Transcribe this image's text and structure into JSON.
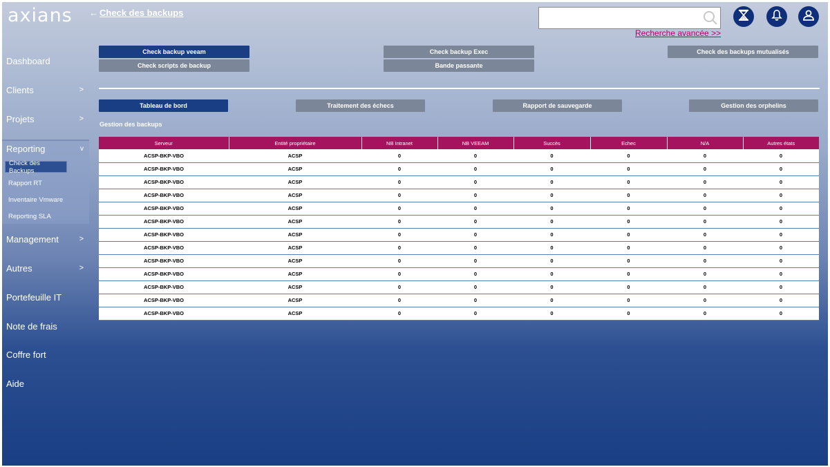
{
  "header": {
    "logo": "axians",
    "back_arrow": "←",
    "title": "Check des backups",
    "search_placeholder": "",
    "advanced_search": "Recherche avancée >>"
  },
  "sidebar": {
    "items": [
      {
        "label": "Dashboard",
        "chevron": ""
      },
      {
        "label": "Clients",
        "chevron": ">"
      },
      {
        "label": "Projets",
        "chevron": ">"
      },
      {
        "label": "Management",
        "chevron": ">"
      },
      {
        "label": "Autres",
        "chevron": ">"
      },
      {
        "label": "Portefeuille IT",
        "chevron": ""
      },
      {
        "label": "Note de frais",
        "chevron": ""
      },
      {
        "label": "Coffre fort",
        "chevron": ""
      },
      {
        "label": "Aide",
        "chevron": ""
      }
    ],
    "reporting": {
      "label": "Reporting",
      "chevron": "v",
      "sub_items": [
        "Check des Backups",
        "Rapport RT",
        "Inventaire Vmware",
        "Reporting SLA"
      ]
    }
  },
  "top_buttons": {
    "check_veeam": "Check backup veeam",
    "check_exec": "Check backup Exec",
    "check_mutualises": "Check des backups mutualisés",
    "check_scripts": "Check scripts de backup",
    "bande_passante": "Bande passante"
  },
  "tabs": {
    "tableau": "Tableau de bord",
    "traitement": "Traitement des échecs",
    "rapport": "Rapport de sauvegarde",
    "orphelins": "Gestion des orphelins"
  },
  "section_title": "Gestion des backups",
  "table": {
    "columns": [
      "Serveur",
      "Entité propriétaire",
      "NB Intranet",
      "NB VEEAM",
      "Succès",
      "Echec",
      "N/A",
      "Autres états"
    ],
    "rows": [
      [
        "ACSP-BKP-VBO",
        "ACSP",
        "0",
        "0",
        "0",
        "0",
        "0",
        "0"
      ],
      [
        "ACSP-BKP-VBO",
        "ACSP",
        "0",
        "0",
        "0",
        "0",
        "0",
        "0"
      ],
      [
        "ACSP-BKP-VBO",
        "ACSP",
        "0",
        "0",
        "0",
        "0",
        "0",
        "0"
      ],
      [
        "ACSP-BKP-VBO",
        "ACSP",
        "0",
        "0",
        "0",
        "0",
        "0",
        "0"
      ],
      [
        "ACSP-BKP-VBO",
        "ACSP",
        "0",
        "0",
        "0",
        "0",
        "0",
        "0"
      ],
      [
        "ACSP-BKP-VBO",
        "ACSP",
        "0",
        "0",
        "0",
        "0",
        "0",
        "0"
      ],
      [
        "ACSP-BKP-VBO",
        "ACSP",
        "0",
        "0",
        "0",
        "0",
        "0",
        "0"
      ],
      [
        "ACSP-BKP-VBO",
        "ACSP",
        "0",
        "0",
        "0",
        "0",
        "0",
        "0"
      ],
      [
        "ACSP-BKP-VBO",
        "ACSP",
        "0",
        "0",
        "0",
        "0",
        "0",
        "0"
      ],
      [
        "ACSP-BKP-VBO",
        "ACSP",
        "0",
        "0",
        "0",
        "0",
        "0",
        "0"
      ],
      [
        "ACSP-BKP-VBO",
        "ACSP",
        "0",
        "0",
        "0",
        "0",
        "0",
        "0"
      ],
      [
        "ACSP-BKP-VBO",
        "ACSP",
        "0",
        "0",
        "0",
        "0",
        "0",
        "0"
      ],
      [
        "ACSP-BKP-VBO",
        "ACSP",
        "0",
        "0",
        "0",
        "0",
        "0",
        "0"
      ]
    ]
  },
  "icons": {
    "search": "search-icon",
    "hourglass": "hourglass-icon",
    "bell": "bell-icon",
    "user": "user-icon"
  },
  "colors": {
    "accent_dark": "#1a3e84",
    "table_header": "#a5135f",
    "link": "#b0006b",
    "button_gray": "#7b8698"
  }
}
